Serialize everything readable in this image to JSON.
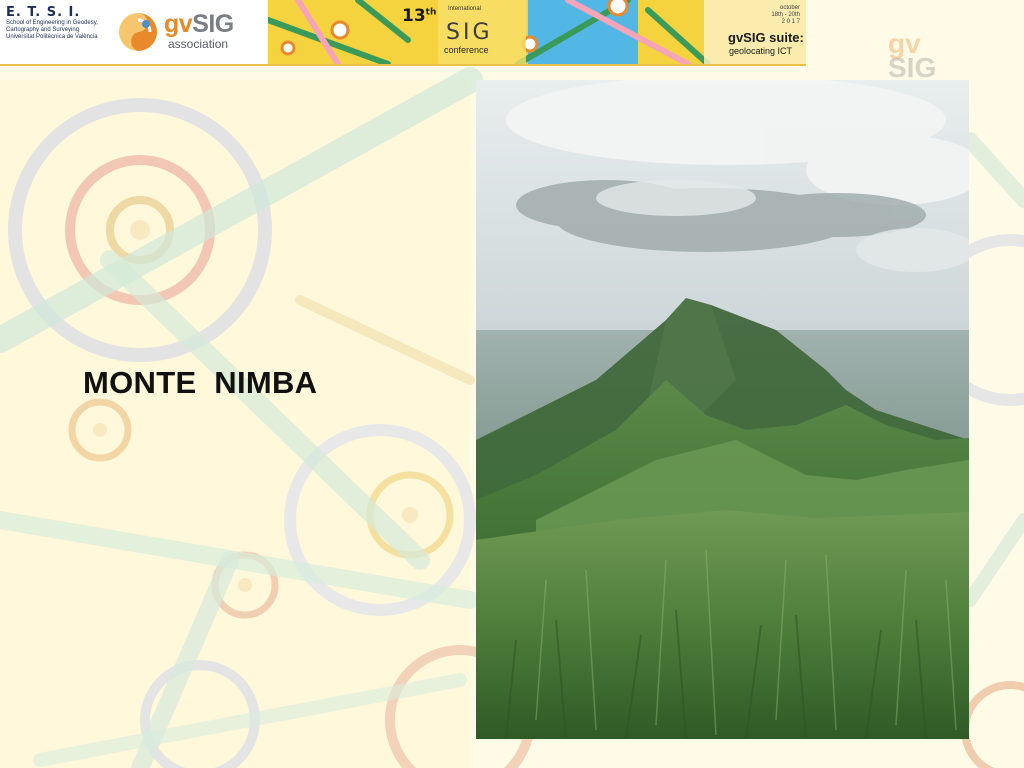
{
  "header": {
    "etsi": {
      "title": "E. T. S. I.",
      "lines": [
        "School of Engineering in Geodesy,",
        "Cartography and Surveying",
        "Universitat Politècnica de València"
      ]
    },
    "gvsig_logo": {
      "word_g": "gv",
      "word_rest": "SIG",
      "subtitle": "association",
      "icon": "gvsig-swirl-icon"
    },
    "conference": {
      "number": "13",
      "number_suffix": "th",
      "small_label": "International",
      "name": "SIG",
      "word": "conference",
      "date_lines": [
        "october",
        "18th - 20th",
        "2 0 1 7"
      ],
      "suite_title": "gvSIG suite:",
      "suite_subtitle": "geolocating ICT"
    }
  },
  "watermark": {
    "g": "gv",
    "rest": "SIG"
  },
  "slide": {
    "title": "MONTE  NIMBA"
  },
  "photo": {
    "icon": "mountain-photo",
    "alt": "Mount Nimba grassy summit under clouds"
  },
  "colors": {
    "background": "#fffbe8",
    "banner_yellow": "#f4d33e",
    "brand_orange": "#e8892c",
    "title_text": "#111111"
  }
}
